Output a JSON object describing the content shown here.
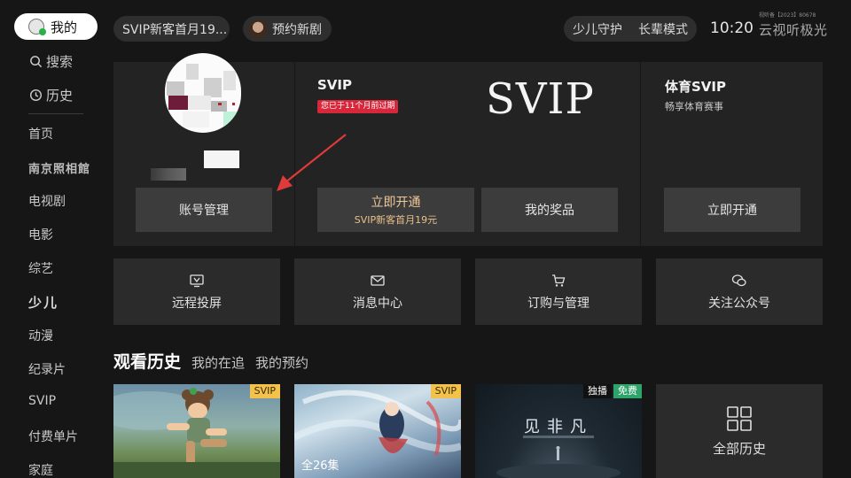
{
  "sidebar": {
    "me_label": "我的",
    "search_label": "搜索",
    "history_label": "历史",
    "items": [
      {
        "label": "首页"
      },
      {
        "label": "南京照相館"
      },
      {
        "label": "电视剧"
      },
      {
        "label": "电影"
      },
      {
        "label": "综艺"
      },
      {
        "label": "少儿"
      },
      {
        "label": "动漫"
      },
      {
        "label": "纪录片"
      },
      {
        "label": "SVIP"
      },
      {
        "label": "付费单片"
      },
      {
        "label": "家庭"
      }
    ]
  },
  "topbar": {
    "promo_chip": "SVIP新客首月19...",
    "reserve_chip": "预约新剧",
    "kids_guard": "少儿守护",
    "elder_mode": "长辈模式",
    "clock": "10:20",
    "license": "视听备【2023】80678",
    "brand": "云视听极光"
  },
  "account": {
    "manage_button": "账号管理",
    "svip_title": "SVIP",
    "expire_tag": "您已于11个月前过期",
    "svip_logo": "SVIP",
    "open_button": "立即开通",
    "open_sub": "SVIP新客首月19元",
    "prize_button": "我的奖品",
    "sports_title": "体育SVIP",
    "sports_sub": "畅享体育赛事",
    "sports_open_button": "立即开通"
  },
  "actions": [
    {
      "label": "远程投屏",
      "icon": "tv-cast-icon"
    },
    {
      "label": "消息中心",
      "icon": "mail-icon"
    },
    {
      "label": "订购与管理",
      "icon": "cart-icon"
    },
    {
      "label": "关注公众号",
      "icon": "wechat-icon"
    }
  ],
  "history": {
    "tabs": [
      "观看历史",
      "我的在追",
      "我的预约"
    ],
    "cards": [
      {
        "tag": "SVIP"
      },
      {
        "tag": "SVIP",
        "episodes": "全26集"
      },
      {
        "exclusive": "独播",
        "free": "免费",
        "title": "见非凡"
      }
    ],
    "all_label": "全部历史"
  },
  "colors": {
    "background": "#161616",
    "panel": "#232323",
    "button": "#3c3c3c",
    "svip_gold": "#f3c24d",
    "expire_red": "#d8263a",
    "free_green": "#2ea46a",
    "arrow_red": "#e03a3a"
  }
}
